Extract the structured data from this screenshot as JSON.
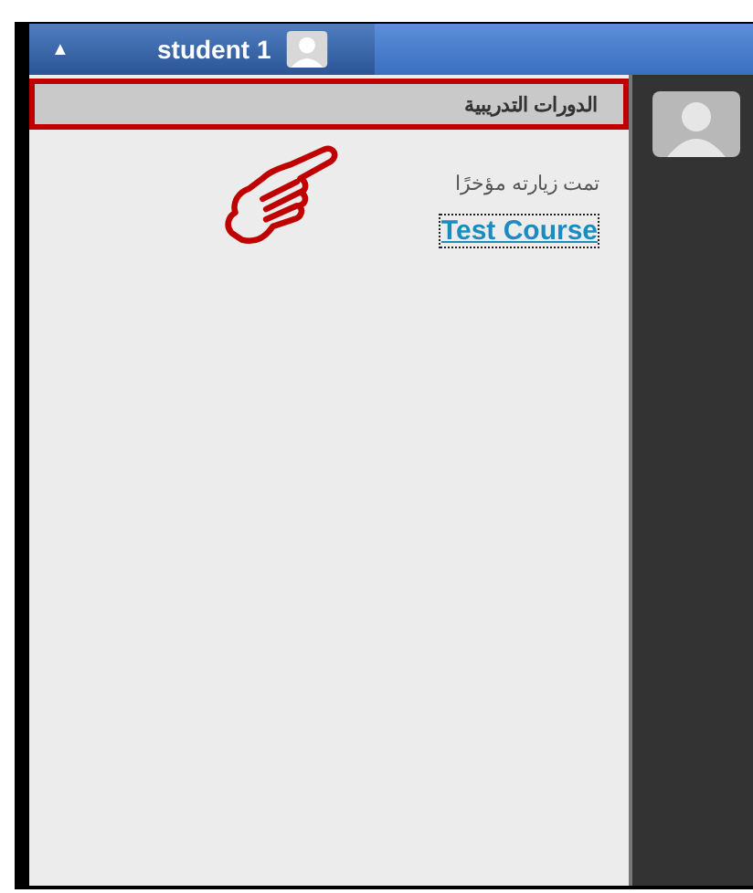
{
  "user_menu": {
    "caret": "▲",
    "name": "student 1"
  },
  "panel": {
    "heading": "الدورات التدريبية",
    "heading_highlighted": true,
    "section_label": "تمت زيارته مؤخرًا",
    "courses": [
      {
        "title": "Test Course",
        "focused": true
      }
    ]
  }
}
